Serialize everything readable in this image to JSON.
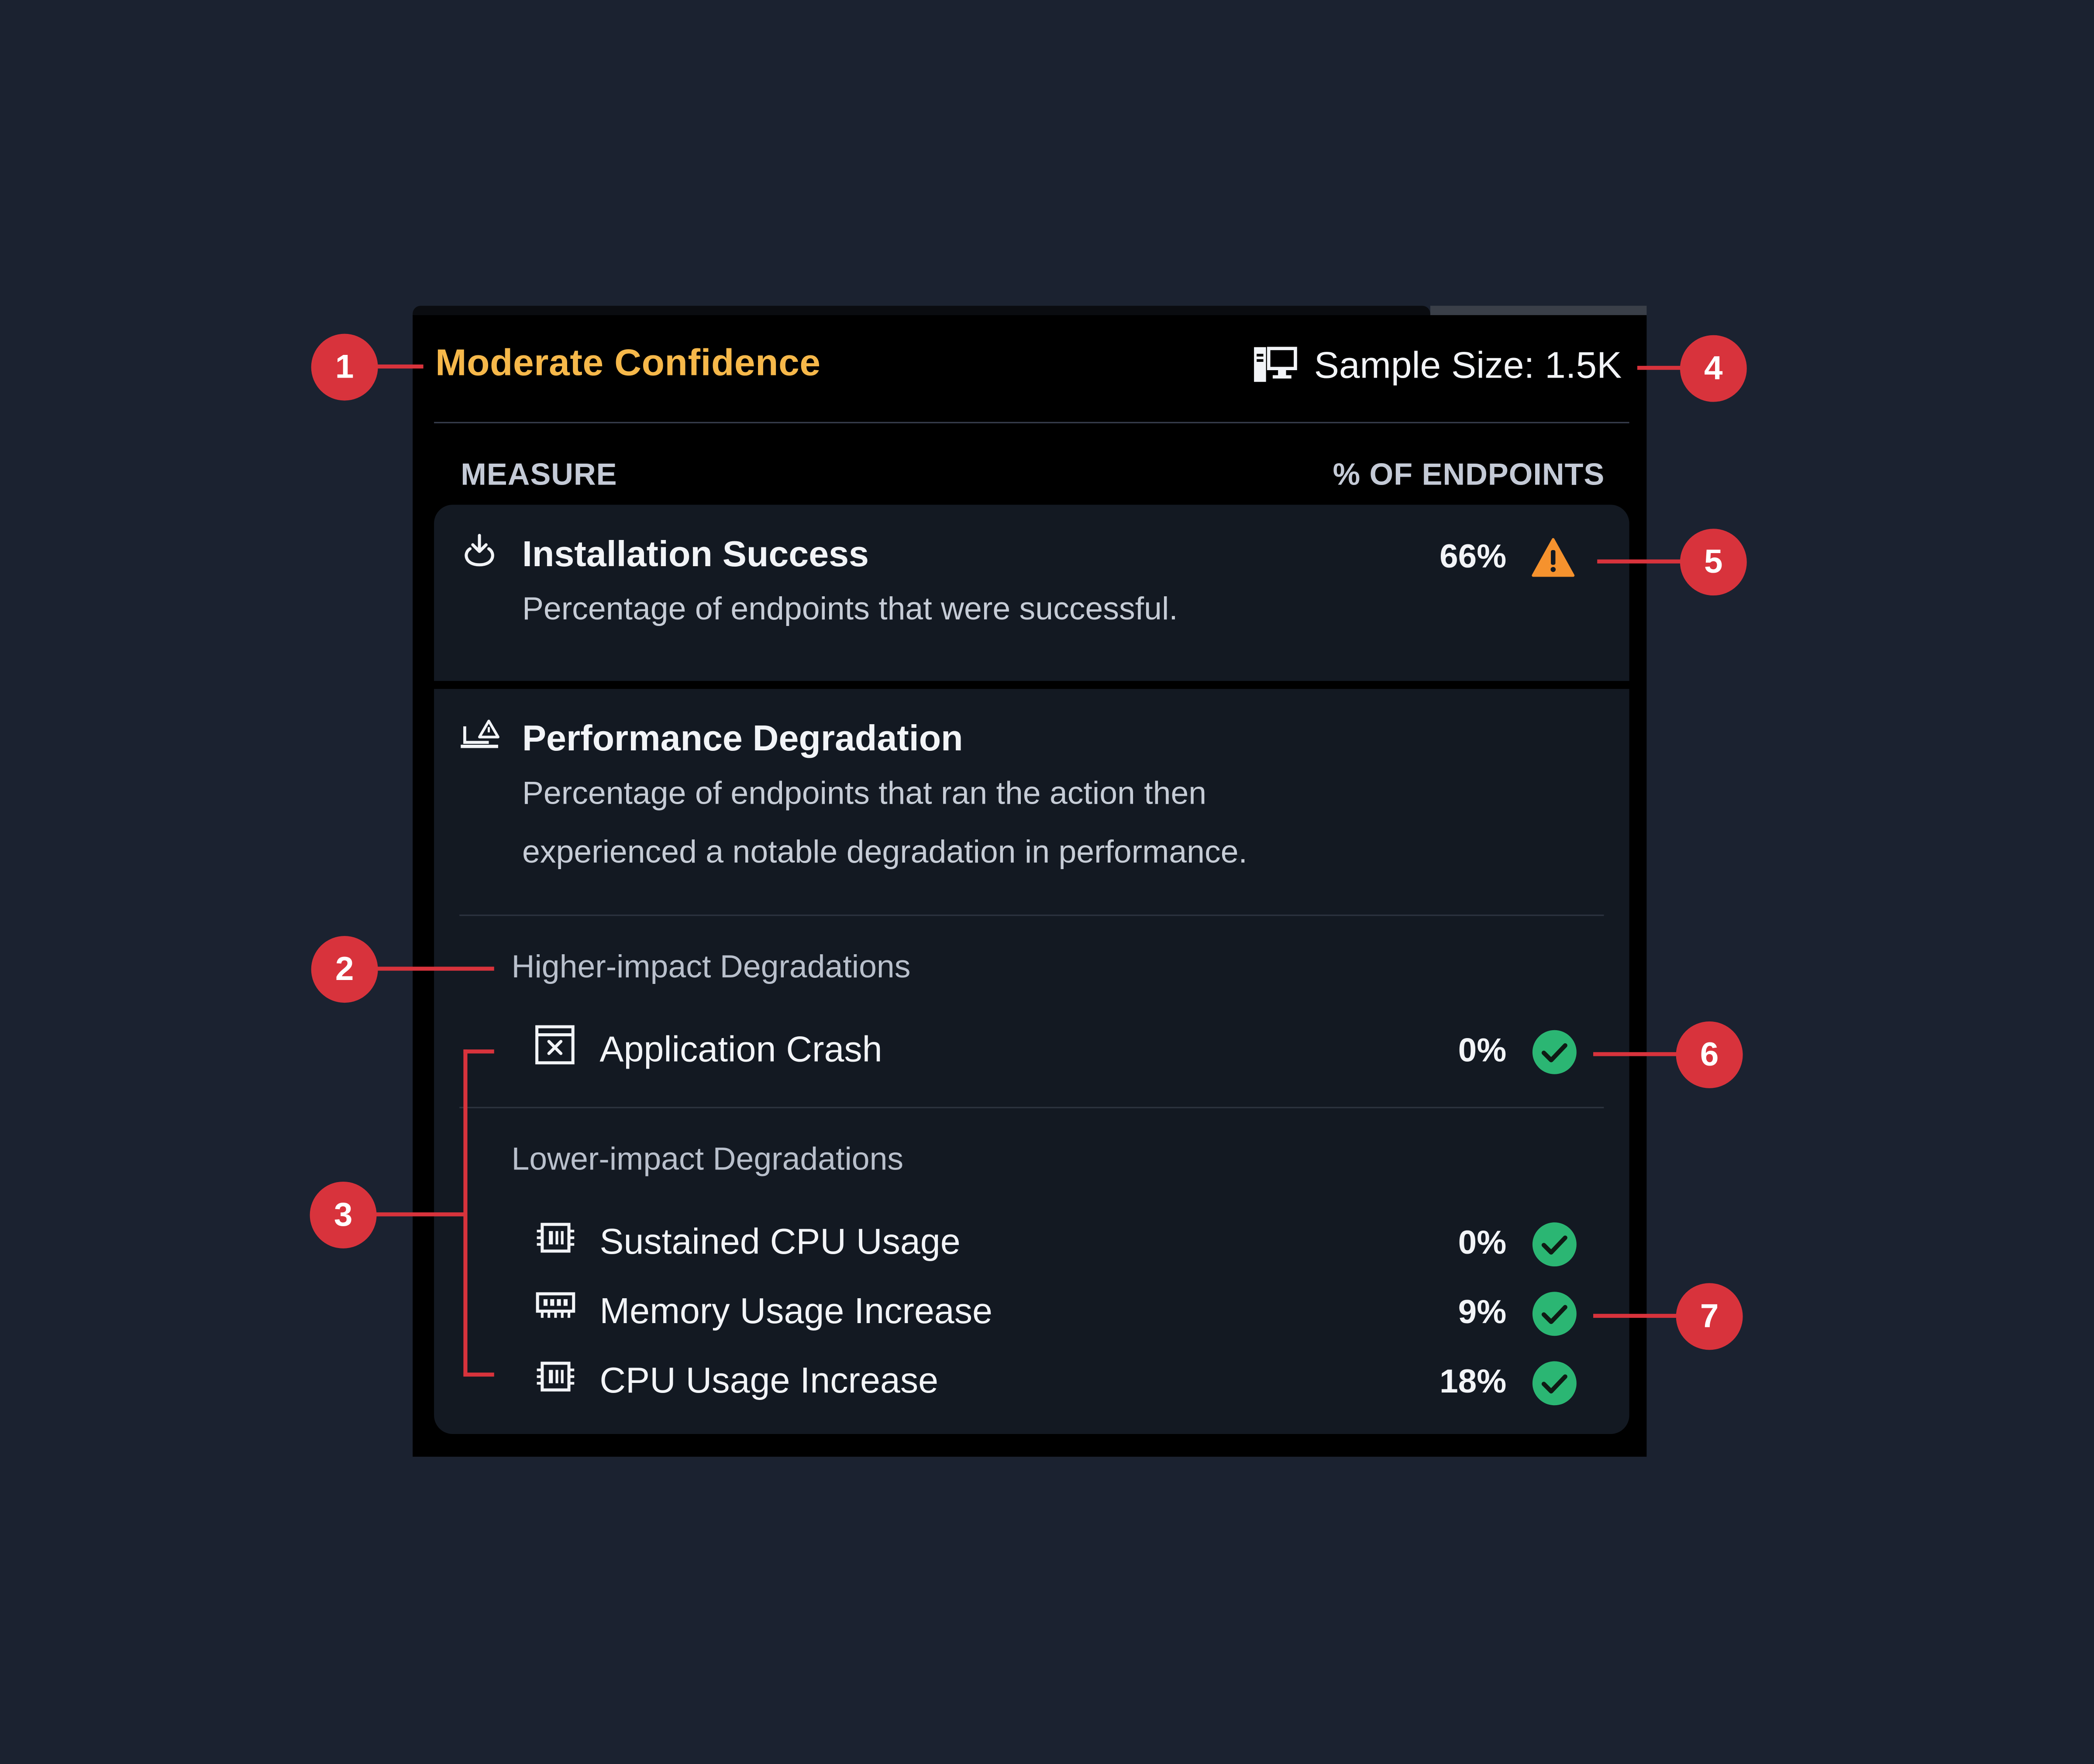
{
  "header": {
    "confidence": "Moderate Confidence",
    "sample_size": "Sample Size: 1.5K",
    "sample_icon": "computer-icon"
  },
  "columns": {
    "measure": "MEASURE",
    "endpoints": "% OF ENDPOINTS"
  },
  "installation": {
    "title": "Installation Success",
    "description": "Percentage of endpoints that were successful.",
    "percent": "66%",
    "status": "warning",
    "status_color": "#f5922e"
  },
  "performance": {
    "title": "Performance Degradation",
    "description_line1": "Percentage of endpoints that ran the action then",
    "description_line2": "experienced a notable degradation in performance."
  },
  "higher_impact": {
    "label": "Higher-impact Degradations",
    "items": [
      {
        "label": "Application Crash",
        "percent": "0%",
        "icon": "app-crash-icon",
        "status": "ok"
      }
    ]
  },
  "lower_impact": {
    "label": "Lower-impact Degradations",
    "items": [
      {
        "label": "Sustained CPU Usage",
        "percent": "0%",
        "icon": "cpu-icon",
        "status": "ok"
      },
      {
        "label": "Memory Usage Increase",
        "percent": "9%",
        "icon": "memory-icon",
        "status": "ok"
      },
      {
        "label": "CPU Usage Increase",
        "percent": "18%",
        "icon": "cpu-icon",
        "status": "ok"
      }
    ]
  },
  "callouts": [
    "1",
    "2",
    "3",
    "4",
    "5",
    "6",
    "7"
  ],
  "colors": {
    "accent": "#f6b84a",
    "ok": "#2bb673",
    "warning": "#f5922e",
    "callout": "#d8333c"
  }
}
